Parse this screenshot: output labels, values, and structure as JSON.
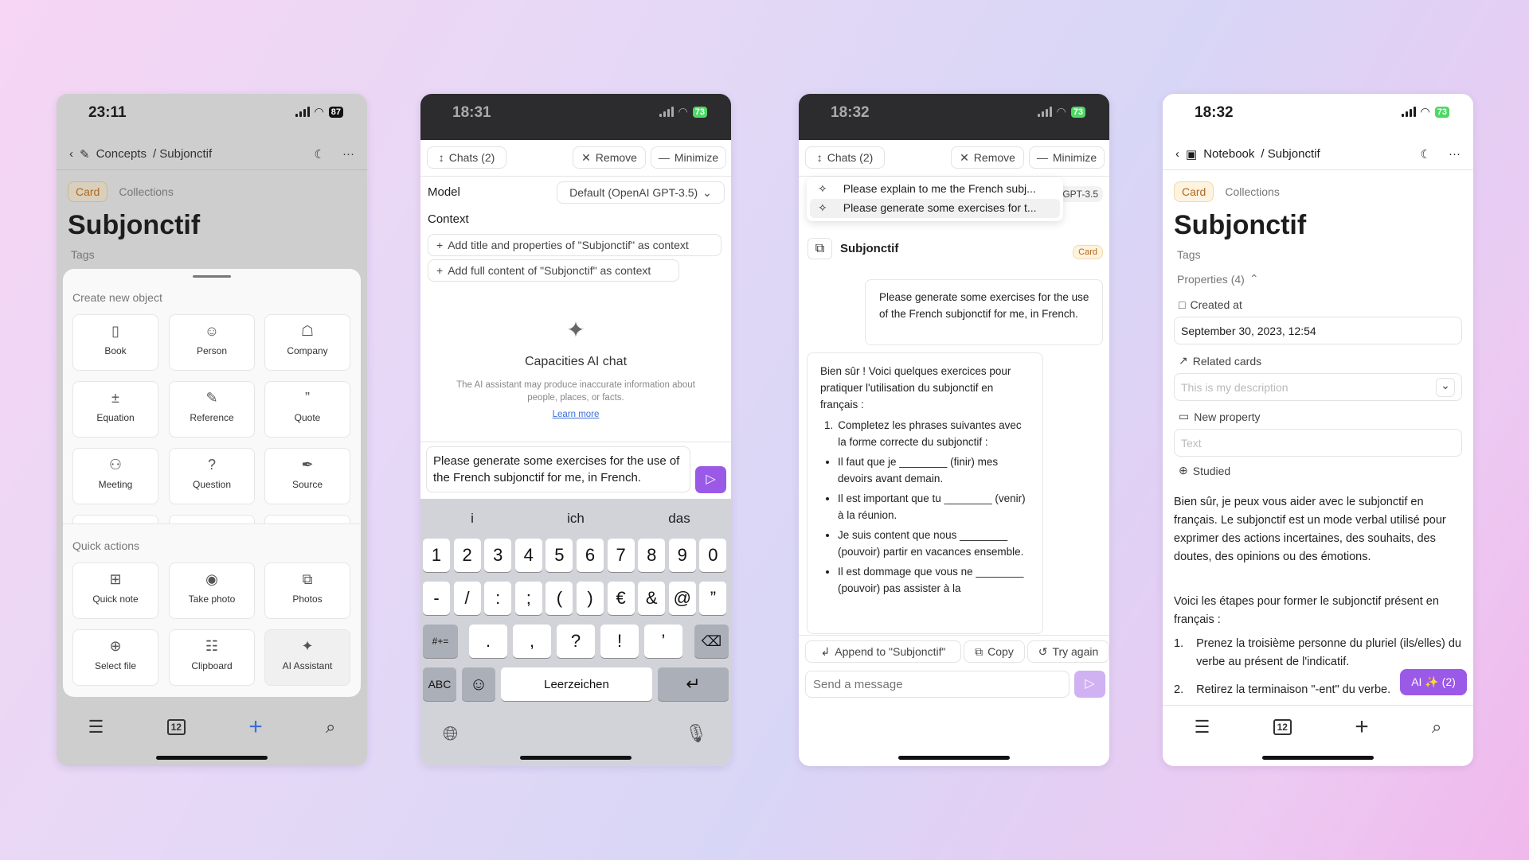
{
  "colors": {
    "accent": "#9b59e8",
    "card_chip": "#b5651d",
    "battery_green": "#4cd964"
  },
  "phone1": {
    "status": {
      "time": "23:11",
      "battery": "87"
    },
    "nav": {
      "folder": "Concepts",
      "page": "/ Subjonctif"
    },
    "chips": {
      "card": "Card",
      "collections": "Collections"
    },
    "title": "Subjonctif",
    "tags": "Tags",
    "sheet": {
      "create_label": "Create new object",
      "objects": [
        {
          "label": "Book",
          "icon": "book-icon"
        },
        {
          "label": "Person",
          "icon": "person-icon"
        },
        {
          "label": "Company",
          "icon": "company-icon"
        },
        {
          "label": "Equation",
          "icon": "equation-icon"
        },
        {
          "label": "Reference",
          "icon": "reference-icon"
        },
        {
          "label": "Quote",
          "icon": "quote-icon"
        },
        {
          "label": "Meeting",
          "icon": "meeting-icon"
        },
        {
          "label": "Question",
          "icon": "question-icon"
        },
        {
          "label": "Source",
          "icon": "pen-icon"
        }
      ],
      "quick_label": "Quick actions",
      "actions": [
        {
          "label": "Quick note",
          "icon": "calendar-plus-icon"
        },
        {
          "label": "Take photo",
          "icon": "camera-icon"
        },
        {
          "label": "Photos",
          "icon": "photos-icon"
        },
        {
          "label": "Select file",
          "icon": "file-plus-icon"
        },
        {
          "label": "Clipboard",
          "icon": "clipboard-icon"
        },
        {
          "label": "AI Assistant",
          "icon": "sparkle-icon"
        }
      ]
    },
    "calendar_day": "12"
  },
  "phone2": {
    "status": {
      "time": "18:31",
      "battery": "73"
    },
    "toolbar": {
      "chats": "Chats (2)",
      "remove": "Remove",
      "minimize": "Minimize"
    },
    "model_label": "Model",
    "model_value": "Default (OpenAI GPT-3.5)",
    "context_label": "Context",
    "context_buttons": [
      "Add title and properties of \"Subjonctif\" as context",
      "Add full content of \"Subjonctif\" as context"
    ],
    "empty": {
      "title": "Capacities AI chat",
      "disclaimer": "The AI assistant may produce inaccurate information about people, places, or facts.",
      "learn_more": "Learn more"
    },
    "input": "Please generate some exercises for the use of the French subjonctif for me, in French.",
    "keyboard": {
      "suggestions": [
        "i",
        "ich",
        "das"
      ],
      "row1": [
        "1",
        "2",
        "3",
        "4",
        "5",
        "6",
        "7",
        "8",
        "9",
        "0"
      ],
      "row2": [
        "-",
        "/",
        ":",
        ";",
        "(",
        ")",
        "€",
        "&",
        "@",
        "”"
      ],
      "row3": [
        "#+=",
        ".",
        ",",
        "?",
        "!",
        "’"
      ],
      "abc": "ABC",
      "space": "Leerzeichen"
    }
  },
  "phone3": {
    "status": {
      "time": "18:32",
      "battery": "73"
    },
    "toolbar": {
      "chats": "Chats (2)",
      "remove": "Remove",
      "minimize": "Minimize"
    },
    "chat_list": [
      "Please explain to me the French subj...",
      "Please generate some exercises for t..."
    ],
    "model_partial": "GPT-3.5",
    "context_title": "Subjonctif",
    "context_badge": "Card",
    "user_message": "Please generate some exercises for the use of the French subjonctif for me, in French.",
    "assistant": {
      "intro": "Bien sûr ! Voici quelques exercices pour pratiquer l'utilisation du subjonctif en français :",
      "step1": "Completez les phrases suivantes avec la forme correcte du subjonctif :",
      "bullets": [
        "Il faut que je ________ (finir) mes devoirs avant demain.",
        "Il est important que tu ________ (venir) à la réunion.",
        "Je suis content que nous ________ (pouvoir) partir en vacances ensemble.",
        "Il est dommage que vous ne ________ (pouvoir) pas assister à la"
      ]
    },
    "actions": {
      "append": "Append to \"Subjonctif\"",
      "copy": "Copy",
      "retry": "Try again"
    },
    "input_placeholder": "Send a message"
  },
  "phone4": {
    "status": {
      "time": "18:32",
      "battery": "73"
    },
    "nav": {
      "folder": "Notebook",
      "page": "/ Subjonctif"
    },
    "chips": {
      "card": "Card",
      "collections": "Collections"
    },
    "title": "Subjonctif",
    "tags": "Tags",
    "properties_label": "Properties (4)",
    "created_label": "Created at",
    "created_value": "September 30, 2023, 12:54",
    "related_label": "Related cards",
    "related_placeholder": "This is my description",
    "newprop_label": "New property",
    "newprop_placeholder": "Text",
    "studied_label": "Studied",
    "body": [
      "Bien sûr, je peux vous aider avec le subjonctif en français. Le subjonctif est un mode verbal utilisé pour exprimer des actions incertaines, des souhaits, des doutes, des opinions ou des émotions.",
      "Voici les étapes pour former le subjonctif présent en français :"
    ],
    "steps": [
      {
        "n": "1.",
        "text": "Prenez la troisième personne du pluriel (ils/elles) du verbe au présent de l'indicatif."
      },
      {
        "n": "2.",
        "text": "Retirez la terminaison \"-ent\" du verbe."
      }
    ],
    "ai_button": "AI ✨ (2)",
    "calendar_day": "12"
  }
}
